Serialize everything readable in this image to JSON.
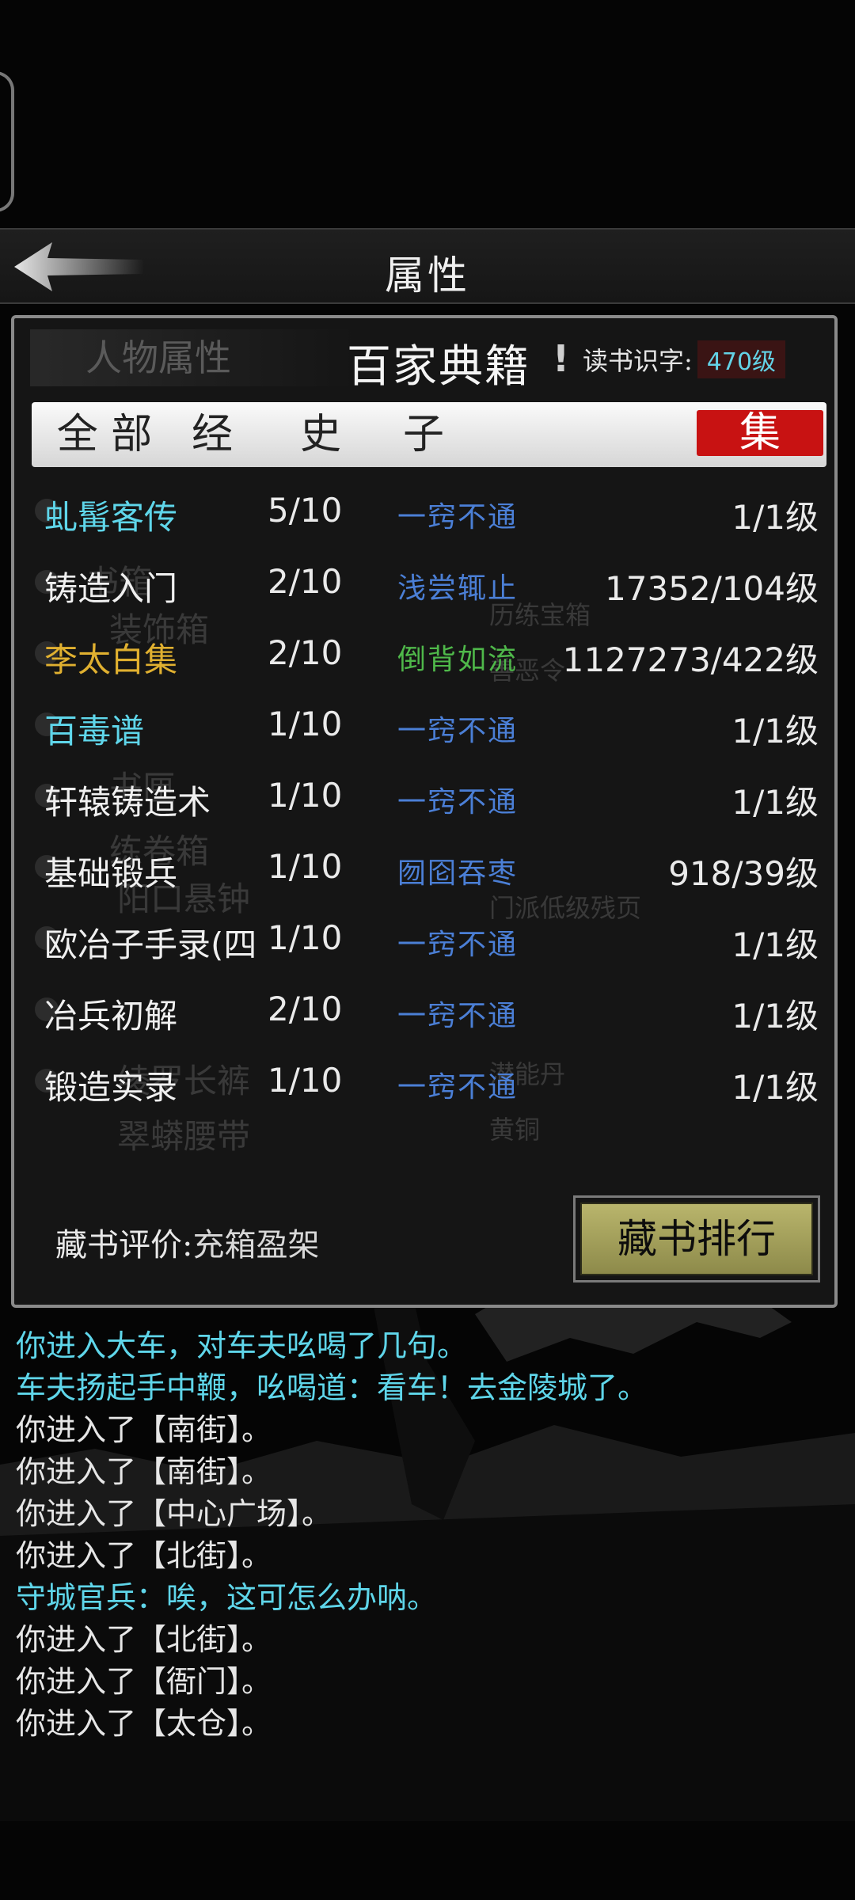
{
  "header": {
    "title": "属性"
  },
  "panel": {
    "left_tab_ghost": "人物属性",
    "title": "百家典籍",
    "alert_mark": "!",
    "read_label": "读书识字:",
    "read_value": "470级"
  },
  "tabs": [
    {
      "label": "全 部",
      "active": false
    },
    {
      "label": "经",
      "active": false
    },
    {
      "label": "史",
      "active": false
    },
    {
      "label": "子",
      "active": false
    },
    {
      "label": "集",
      "active": true
    }
  ],
  "books": [
    {
      "name": "虬髯客传",
      "progress": "5/10",
      "level": "一窍不通",
      "exp": "1/1级",
      "name_color": "#5fd6ea",
      "level_color": "#4b7fd6"
    },
    {
      "name": "铸造入门",
      "progress": "2/10",
      "level": "浅尝辄止",
      "exp": "17352/104级",
      "name_color": "#f0f0f0",
      "level_color": "#4b7fd6"
    },
    {
      "name": "李太白集",
      "progress": "2/10",
      "level": "倒背如流",
      "exp": "1127273/422级",
      "name_color": "#e0b030",
      "level_color": "#4fb84a"
    },
    {
      "name": "百毒谱",
      "progress": "1/10",
      "level": "一窍不通",
      "exp": "1/1级",
      "name_color": "#5fd6ea",
      "level_color": "#4b7fd6"
    },
    {
      "name": "轩辕铸造术",
      "progress": "1/10",
      "level": "一窍不通",
      "exp": "1/1级",
      "name_color": "#f0f0f0",
      "level_color": "#4b7fd6"
    },
    {
      "name": "基础锻兵",
      "progress": "1/10",
      "level": "囫囵吞枣",
      "exp": "918/39级",
      "name_color": "#f0f0f0",
      "level_color": "#4b7fd6"
    },
    {
      "name": "欧冶子手录(四",
      "progress": "1/10",
      "level": "一窍不通",
      "exp": "1/1级",
      "name_color": "#f0f0f0",
      "level_color": "#4b7fd6"
    },
    {
      "name": "冶兵初解",
      "progress": "2/10",
      "level": "一窍不通",
      "exp": "1/1级",
      "name_color": "#f0f0f0",
      "level_color": "#4b7fd6"
    },
    {
      "name": "锻造实录",
      "progress": "1/10",
      "level": "一窍不通",
      "exp": "1/1级",
      "name_color": "#f0f0f0",
      "level_color": "#4b7fd6"
    }
  ],
  "bottom": {
    "rating_label": "藏书评价:",
    "rating_value": "充箱盈架",
    "rank_button": "藏书排行"
  },
  "log": [
    {
      "text": "你进入大车，对车夫吆喝了几句。",
      "color": "#5fd6ea"
    },
    {
      "text": "车夫扬起手中鞭，吆喝道：看车！去金陵城了。",
      "color": "#5fd6ea"
    },
    {
      "text": "你进入了【南街】。",
      "color": "#e6e6e6"
    },
    {
      "text": "你进入了【南街】。",
      "color": "#e6e6e6"
    },
    {
      "text": "你进入了【中心广场】。",
      "color": "#e6e6e6"
    },
    {
      "text": "你进入了【北街】。",
      "color": "#e6e6e6"
    },
    {
      "text": "守城官兵：唉，这可怎么办呐。",
      "color": "#5fd6ea"
    },
    {
      "text": "你进入了【北街】。",
      "color": "#e6e6e6"
    },
    {
      "text": "你进入了【衙门】。",
      "color": "#e6e6e6"
    },
    {
      "text": "你进入了【太仓】。",
      "color": "#e6e6e6"
    }
  ]
}
